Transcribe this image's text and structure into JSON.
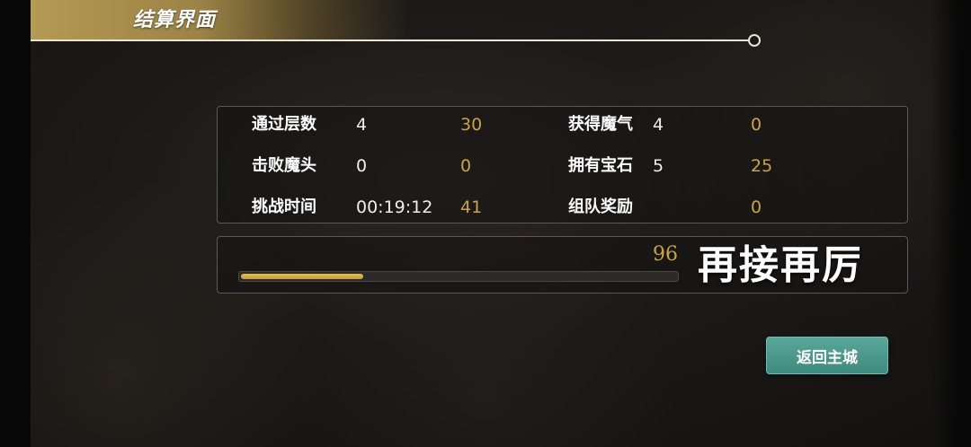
{
  "header": {
    "title": "结算界面"
  },
  "stats": {
    "rows": [
      {
        "left_label": "通过层数",
        "left_value": "4",
        "left_score": "30",
        "right_label": "获得魔气",
        "right_value": "4",
        "right_score": "0"
      },
      {
        "left_label": "击败魔头",
        "left_value": "0",
        "left_score": "0",
        "right_label": "拥有宝石",
        "right_value": "5",
        "right_score": "25"
      },
      {
        "left_label": "挑战时间",
        "left_value": "00:19:12",
        "left_score": "41",
        "right_label": "组队奖励",
        "right_value": "",
        "right_score": "0"
      }
    ]
  },
  "result": {
    "total_score": "96",
    "message": "再接再厉",
    "progress_fraction": 0.28
  },
  "actions": {
    "return_label": "返回主城"
  },
  "colors": {
    "gold": "#c9a444",
    "button": "#4a998c",
    "banner": "#b49a53"
  }
}
